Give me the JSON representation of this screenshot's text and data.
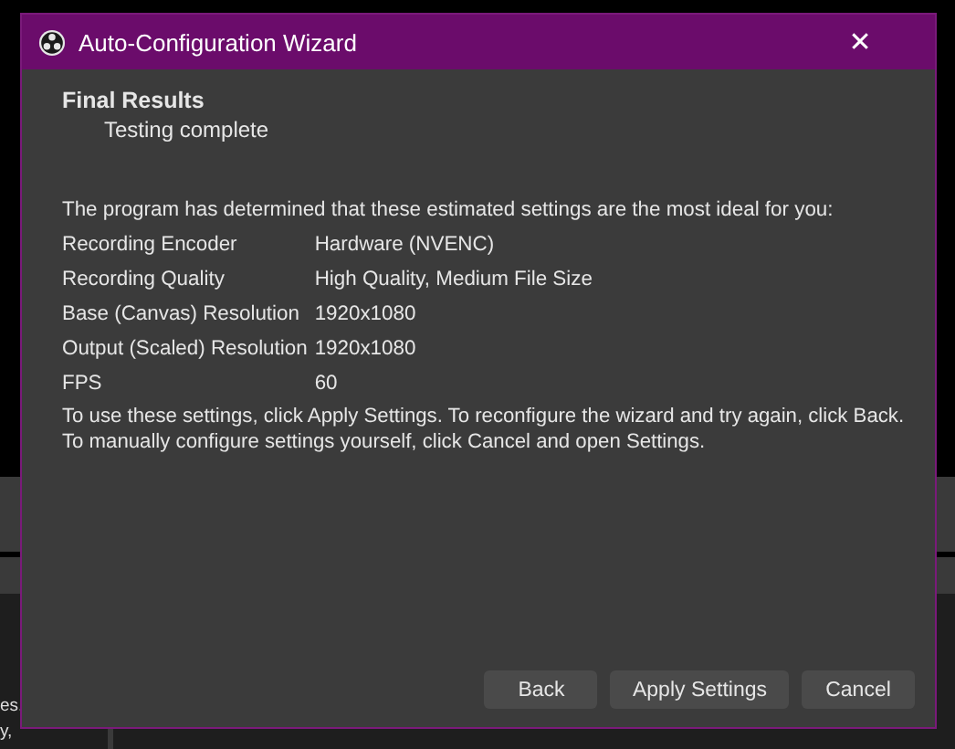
{
  "background_app": {
    "texts": [
      "es.",
      "y,"
    ]
  },
  "window": {
    "title": "Auto-Configuration Wizard",
    "close": "✕"
  },
  "page": {
    "heading": "Final Results",
    "subheading": "Testing complete"
  },
  "intro": "The program has determined that these estimated settings are the most ideal for you:",
  "results": [
    {
      "label": "Recording Encoder",
      "value": "Hardware (NVENC)"
    },
    {
      "label": "Recording Quality",
      "value": "High Quality, Medium File Size"
    },
    {
      "label": "Base (Canvas) Resolution",
      "value": "1920x1080"
    },
    {
      "label": "Output (Scaled) Resolution",
      "value": "1920x1080"
    },
    {
      "label": "FPS",
      "value": "60"
    }
  ],
  "instructions": [
    "To use these settings, click Apply Settings. To reconfigure the wizard and try again, click Back.",
    "To manually configure settings yourself, click Cancel and open Settings."
  ],
  "buttons": [
    "Back",
    "Apply Settings",
    "Cancel"
  ]
}
